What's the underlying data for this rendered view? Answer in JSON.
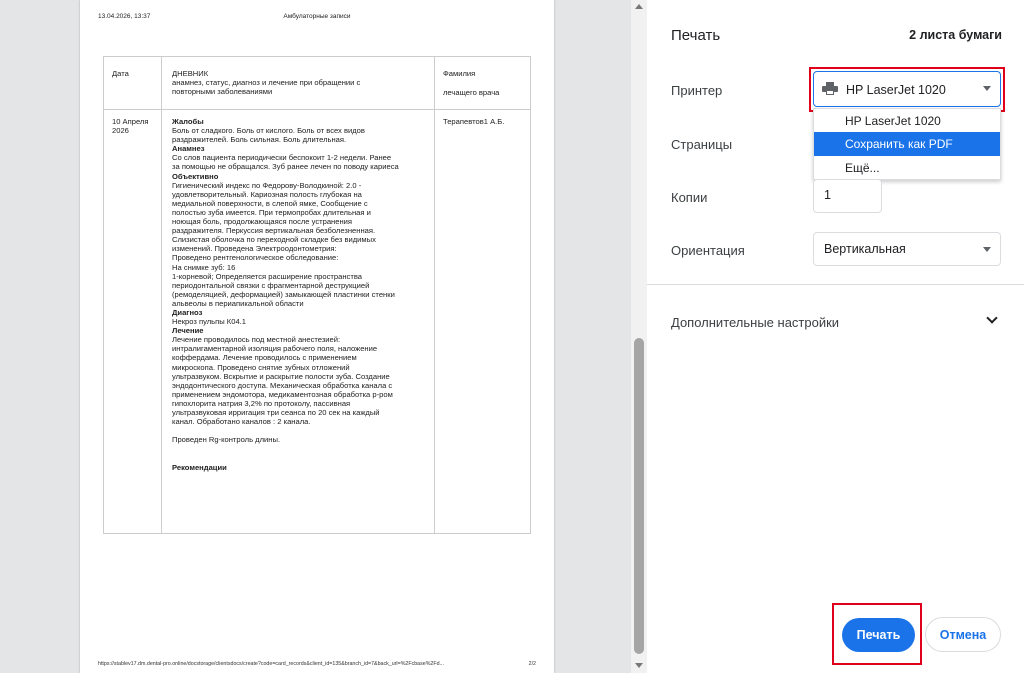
{
  "preview": {
    "header_date": "13.04.2026, 13:37",
    "header_title": "Амбулаторные записи",
    "table_headers": {
      "date": "Дата",
      "diary_title": "ДНЕВНИК",
      "diary_sub1": "анамнез, статус, диагноз и лечение при обращении с",
      "diary_sub2": "повторными заболеваниями",
      "doctor1": "Фамилия",
      "doctor2": "лечащего врача"
    },
    "record": {
      "date_line1": "10 Апреля",
      "date_line2": "2026",
      "doctor": "Терапевтов1 А.Б.",
      "lines": [
        {
          "t": "Жалобы",
          "b": true
        },
        {
          "t": "Боль от сладкого. Боль от кислого. Боль от всех видов"
        },
        {
          "t": "раздражителей. Боль сильная. Боль длительная."
        },
        {
          "t": "Анамнез",
          "b": true
        },
        {
          "t": "Со слов пациента периодически беспокоит 1-2 недели. Ранее"
        },
        {
          "t": "за помощью не обращался. Зуб ранее лечен по поводу кариеса"
        },
        {
          "t": "Объективно",
          "b": true
        },
        {
          "t": "Гигиенический индекс по Федорову-Володкиной: 2.0 -"
        },
        {
          "t": "удовлетворительный. Кариозная полость глубокая на"
        },
        {
          "t": "медиальной поверхности, в слепой ямке, Сообщение с"
        },
        {
          "t": "полостью зуба имеется. При термопробах длительная и"
        },
        {
          "t": "ноющая боль, продолжающаяся после устранения"
        },
        {
          "t": "раздражителя. Перкуссия вертикальная безболезненная."
        },
        {
          "t": "Слизистая оболочка по переходной складке без видимых"
        },
        {
          "t": "изменений. Проведена Электроодонтометрия:"
        },
        {
          "t": "Проведено рентгенологическое обследование:"
        },
        {
          "t": "На снимке зуб: 16"
        },
        {
          "t": "1-корневой; Определяется расширение пространства"
        },
        {
          "t": "периодонтальной связки с фрагментарной деструкцией"
        },
        {
          "t": "(ремоделяцией, деформацией) замыкающей пластинки стенки"
        },
        {
          "t": "альвеолы в периапикальной области"
        },
        {
          "t": "Диагноз",
          "b": true
        },
        {
          "t": "Некроз пульпы К04.1"
        },
        {
          "t": "Лечение",
          "b": true
        },
        {
          "t": "Лечение проводилось под местной анестезией:"
        },
        {
          "t": "интралигаментарной изоляция рабочего поля, наложение"
        },
        {
          "t": "коффердама. Лечение проводилось с применением"
        },
        {
          "t": "микроскопа. Проведено снятие зубных отложений"
        },
        {
          "t": "ультразвуком. Вскрытие и раскрытие полости зуба. Создание"
        },
        {
          "t": "эндодонтического доступа. Механическая обработка канала с"
        },
        {
          "t": "применением эндомотора, медикаментозная обработка р-ром"
        },
        {
          "t": "гипохлорита натрия 3,2% по протоколу, пассивная"
        },
        {
          "t": "ультразвуковая ирригация три сеанса по 20 сек на каждый"
        },
        {
          "t": "канал. Обработано каналов : 2 канала."
        },
        {
          "t": ""
        },
        {
          "t": "Проведен Rg-контроль длины."
        },
        {
          "t": ""
        },
        {
          "t": ""
        },
        {
          "t": "Рекомендации",
          "b": true
        }
      ]
    },
    "footer_url": "https://stablev17.dm.dental-pro.online/docstorage/clientsdocs/create?code=card_records&client_id=135&branch_id=7&back_url=%2Fcbase%2Fd...",
    "footer_page": "2/2"
  },
  "panel": {
    "title": "Печать",
    "sheet_count": "2 листа бумаги",
    "printer_label": "Принтер",
    "printer_value": "HP LaserJet 1020",
    "printer_options": [
      "HP LaserJet 1020",
      "Сохранить как PDF",
      "Ещё..."
    ],
    "pages_label": "Страницы",
    "copies_label": "Копии",
    "copies_value": "1",
    "orientation_label": "Ориентация",
    "orientation_value": "Вертикальная",
    "more_settings": "Дополнительные настройки",
    "print_button": "Печать",
    "cancel_button": "Отмена"
  },
  "colors": {
    "accent": "#1a73e8",
    "highlight_box": "#e0001b",
    "preview_bg": "#e4e5e7"
  }
}
